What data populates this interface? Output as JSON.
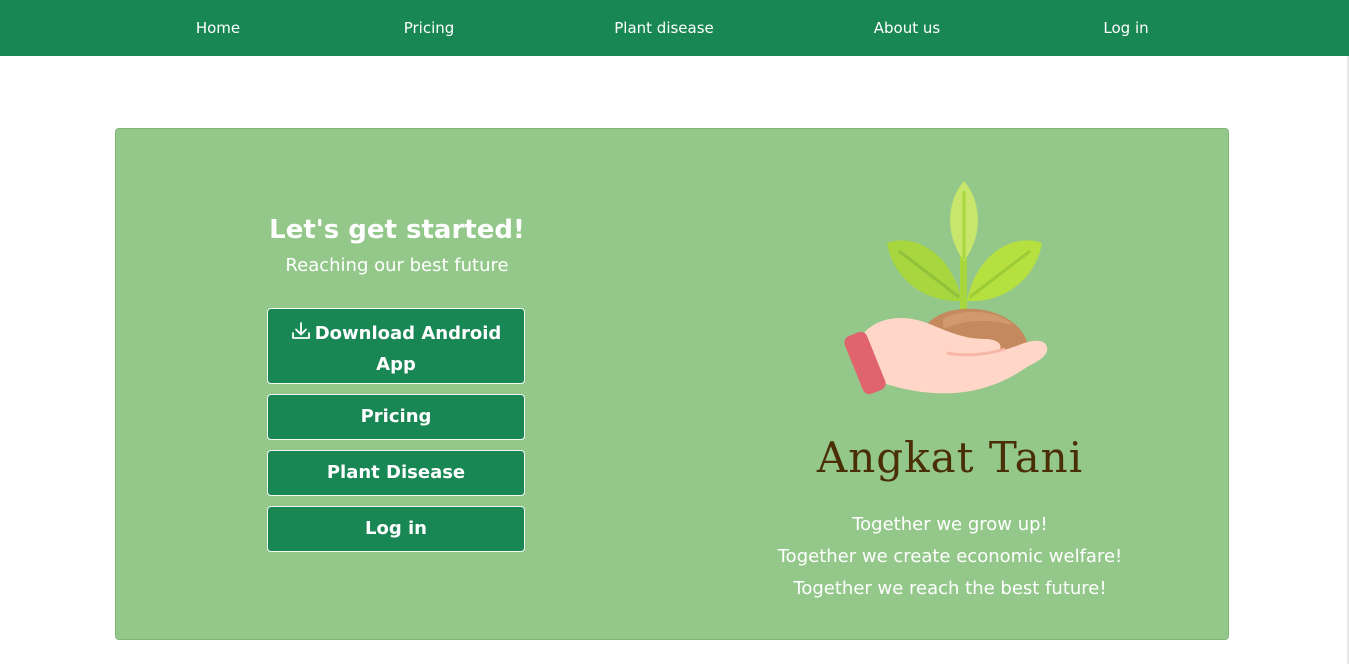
{
  "nav": {
    "home": "Home",
    "pricing": "Pricing",
    "plant_disease": "Plant disease",
    "about": "About us",
    "login": "Log in"
  },
  "hero": {
    "title": "Let's get started!",
    "subtitle": "Reaching our best future",
    "buttons": {
      "download": "Download Android App",
      "download_icon": "download-icon",
      "pricing": "Pricing",
      "plant_disease": "Plant Disease",
      "login": "Log in"
    },
    "brand": "Angkat Tani",
    "taglines": [
      "Together we grow up!",
      "Together we create economic welfare!",
      "Together we reach the best future!"
    ]
  },
  "colors": {
    "primary": "#198754",
    "hero_bg": "#93c88a",
    "brand_text": "#4a2e06"
  }
}
